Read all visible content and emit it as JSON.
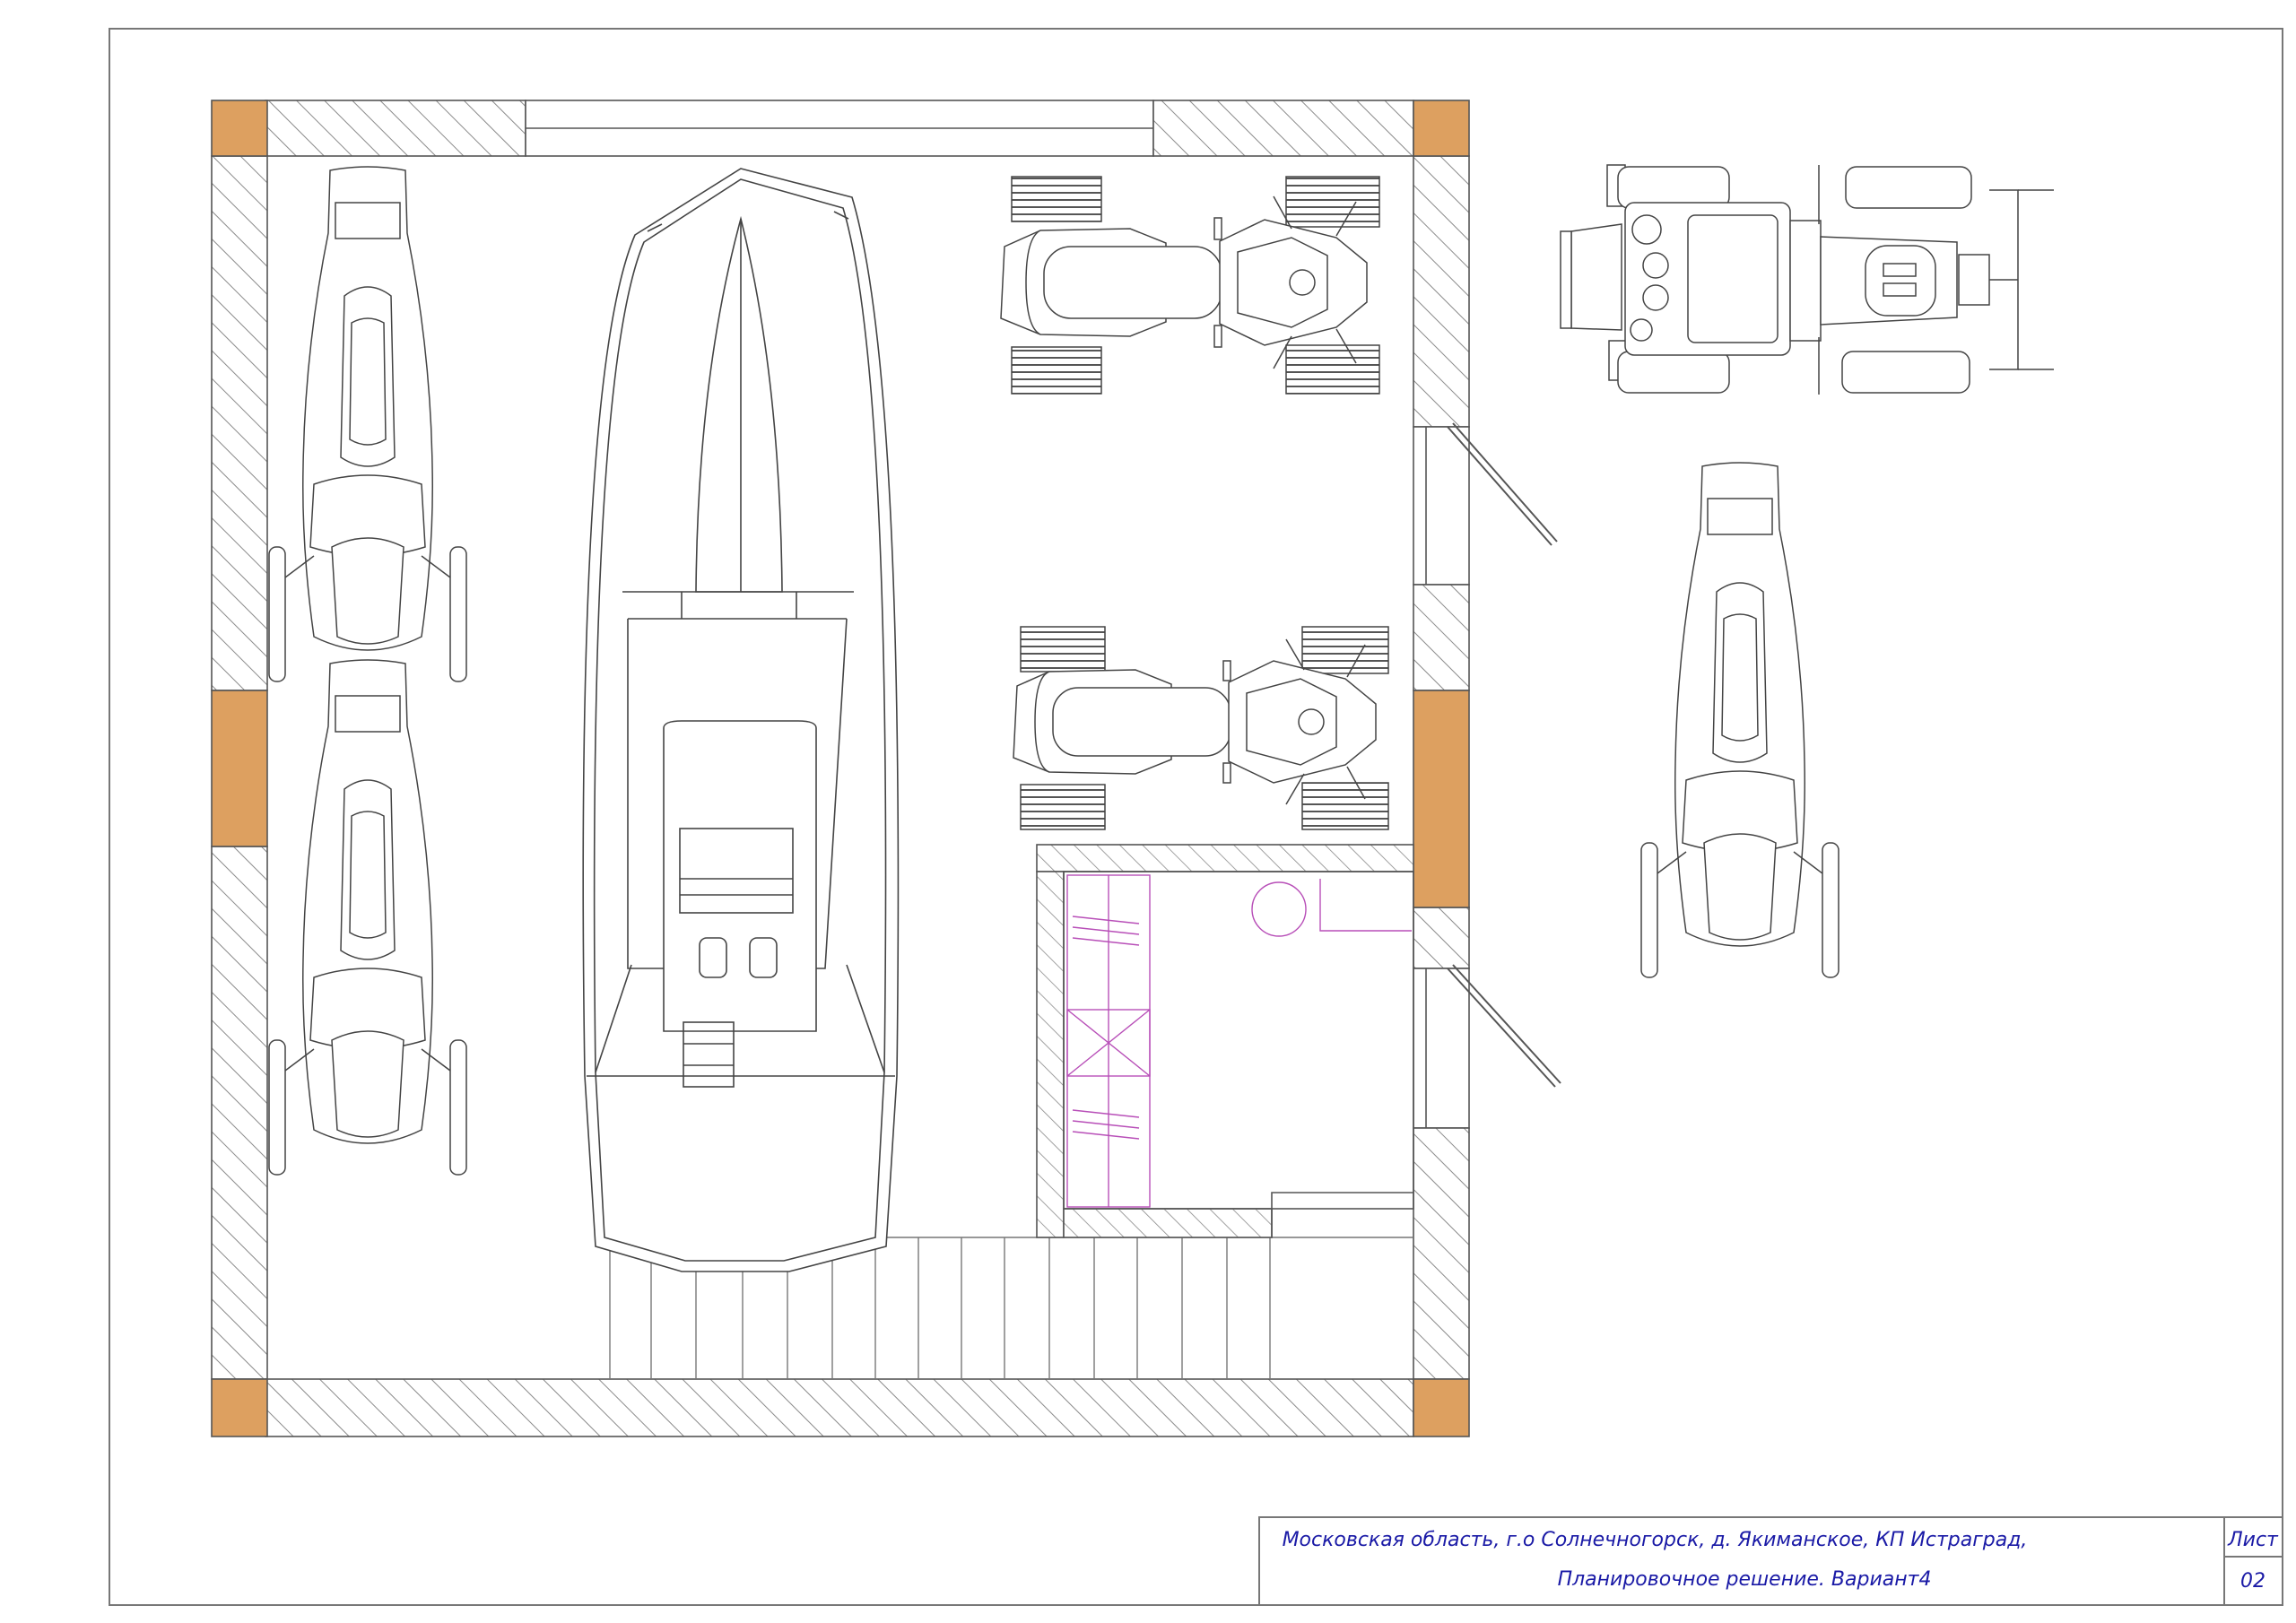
{
  "title_block": {
    "address": "Московская область, г.о Солнечногорск, д. Якиманское, КП Истраград,",
    "subtitle": "Планировочное решение. Вариант4",
    "sheet_label": "Лист",
    "sheet_number": "02"
  },
  "colors": {
    "line": "#5a5a5a",
    "column_fill": "#dda060",
    "hatch": "#8a8a8a",
    "storage_lines": "#b84fb8",
    "title_text": "#1a1aa6"
  }
}
